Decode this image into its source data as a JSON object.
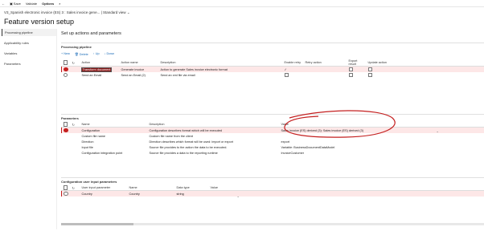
{
  "toolbar": {
    "back_icon": "back-arrow-icon",
    "save": "Save",
    "validate": "Validate",
    "options": "Options",
    "search_icon": "search-icon"
  },
  "breadcrumb": {
    "text": "V3_Spanish electronic invoice (ES) 3 : Sales invoice gene...",
    "view": "Standard view"
  },
  "page_title": "Feature version setup",
  "left_nav": [
    "Processing pipeline",
    "Applicability rules",
    "Variables",
    "Parameters"
  ],
  "setup_title": "Set up actions and parameters",
  "pipeline": {
    "title": "Processing pipeline",
    "actions": {
      "new": "+ New",
      "delete": "Delete",
      "up": "↑ Up",
      "down": "↓ Down"
    },
    "headers": [
      "Action",
      "Action name",
      "Description",
      "Enable retry",
      "Retry action",
      "Export result",
      "Update action"
    ],
    "rows": [
      {
        "action": "Transform document",
        "name": "Generate invoice",
        "description": "Action to generate Sales invoice electronic format"
      },
      {
        "action": "Send an Email",
        "name": "Send an Email (2)",
        "description": "Send an xml file via email"
      }
    ]
  },
  "parameters": {
    "title": "Parameters",
    "headers": [
      "Name",
      "Description",
      "Value"
    ],
    "rows": [
      {
        "name": "Configuration",
        "description": "Configuration describes format which will be executed",
        "value": "Sales invoice (ES) derived (3): Sales invoice (ES) derived (3)"
      },
      {
        "name": "Custom file name",
        "description": "Custom file name from the client",
        "value": ""
      },
      {
        "name": "Direction",
        "description": "Direction describes which format will be used: import or export",
        "value": "export"
      },
      {
        "name": "Input file",
        "description": "Source file provides to the action the data to be executed.",
        "value": "Variable: BusinessDocumentDataModel"
      },
      {
        "name": "Configuration integration point",
        "description": "Source file provides a data to the reporting runtime",
        "value": "InvoiceCustomer"
      }
    ]
  },
  "user_input": {
    "title": "Configuration user input parameters",
    "headers": [
      "User input parameter",
      "Name",
      "Data type",
      "Value"
    ],
    "rows": [
      {
        "param": "Country",
        "name": "Country",
        "type": "string",
        "value": ""
      }
    ]
  },
  "colors": {
    "accent_red": "#c41f1f",
    "selected_row": "#fde7e7",
    "link": "#1a6bb8"
  }
}
